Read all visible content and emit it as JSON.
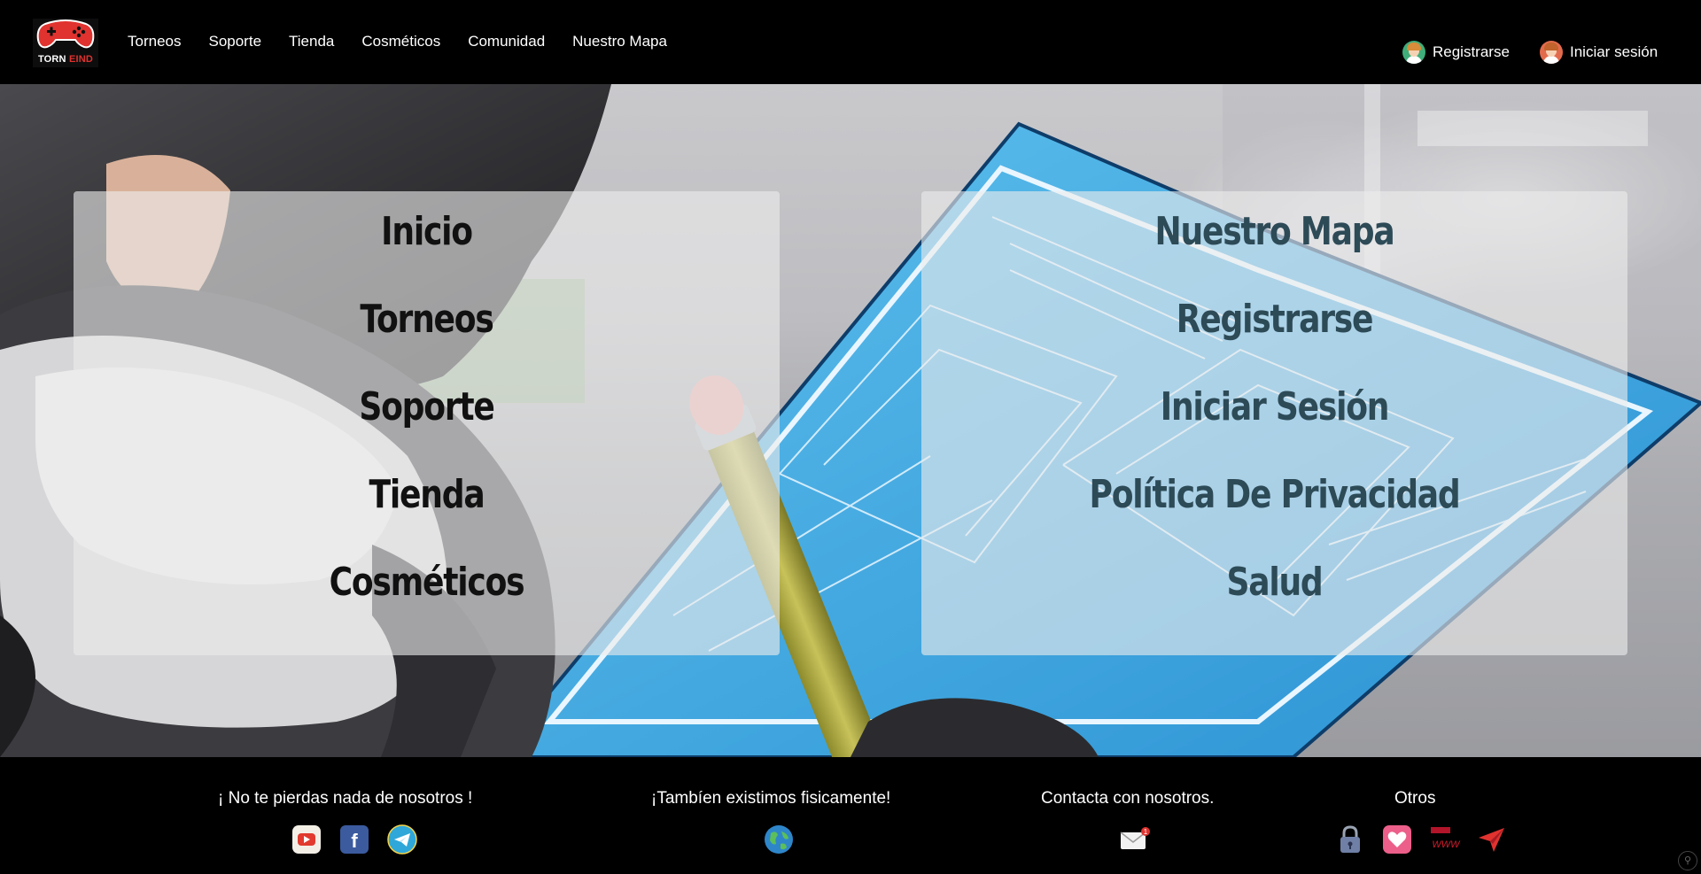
{
  "brand": {
    "logo_text_part1": "TORN",
    "logo_text_part2": "EIND"
  },
  "nav": {
    "items": [
      "Torneos",
      "Soporte",
      "Tienda",
      "Cosméticos",
      "Comunidad",
      "Nuestro Mapa"
    ]
  },
  "auth": {
    "register_label": "Registrarse",
    "login_label": "Iniciar sesión"
  },
  "panels": {
    "left": [
      "Inicio",
      "Torneos",
      "Soporte",
      "Tienda",
      "Cosméticos"
    ],
    "right": [
      "Nuestro Mapa",
      "Registrarse",
      "Iniciar Sesión",
      "Política De Privacidad",
      "Salud"
    ]
  },
  "footer": {
    "col1_title": "¡ No te pierdas nada de nosotros !",
    "col2_title": "¡Tambíen existimos fisicamente!",
    "col3_title": "Contacta con nosotros.",
    "col4_title": "Otros",
    "mail_badge": "1",
    "www_text": "WWW"
  },
  "colors": {
    "accent_red": "#e0322f",
    "header_bg": "#000000",
    "panel_right_text": "#2d4a57"
  },
  "icons": [
    "youtube-icon",
    "facebook-icon",
    "telegram-icon",
    "globe-icon",
    "mail-icon",
    "lock-icon",
    "heart-icon",
    "www-icon",
    "send-icon"
  ]
}
